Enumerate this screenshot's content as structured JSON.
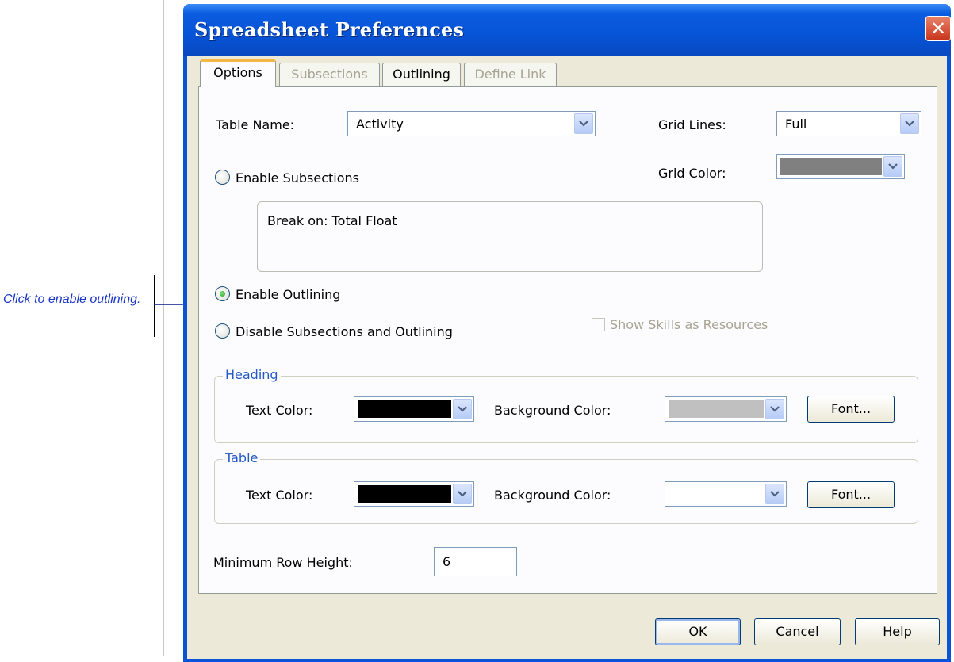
{
  "annotation": {
    "text": "Click to enable outlining."
  },
  "dialog": {
    "title": "Spreadsheet Preferences",
    "close_glyph": "✕",
    "tabs": [
      {
        "label": "Options",
        "state": "active"
      },
      {
        "label": "Subsections",
        "state": "disabled"
      },
      {
        "label": "Outlining",
        "state": "enabled"
      },
      {
        "label": "Define Link",
        "state": "disabled"
      }
    ],
    "table_name": {
      "label": "Table Name:",
      "value": "Activity"
    },
    "grid_lines": {
      "label": "Grid Lines:",
      "value": "Full"
    },
    "grid_color": {
      "label": "Grid Color:",
      "value": "#808080"
    },
    "radios": {
      "enable_subsections": {
        "label": "Enable Subsections",
        "selected": false
      },
      "enable_outlining": {
        "label": "Enable Outlining",
        "selected": true
      },
      "disable_both": {
        "label": "Disable Subsections and Outlining",
        "selected": false
      }
    },
    "break_on": "Break on:  Total Float",
    "show_skills": {
      "label": "Show Skills as Resources",
      "checked": false,
      "enabled": false
    },
    "heading": {
      "legend": "Heading",
      "text_color_label": "Text Color:",
      "text_color": "#000000",
      "bg_color_label": "Background Color:",
      "bg_color": "#c0c0c0",
      "font_button": "Font..."
    },
    "table": {
      "legend": "Table",
      "text_color_label": "Text Color:",
      "text_color": "#000000",
      "bg_color_label": "Background Color:",
      "bg_color": "#ffffff",
      "font_button": "Font..."
    },
    "min_row_height": {
      "label": "Minimum Row Height:",
      "value": "6"
    },
    "buttons": {
      "ok": "OK",
      "cancel": "Cancel",
      "help": "Help"
    }
  }
}
